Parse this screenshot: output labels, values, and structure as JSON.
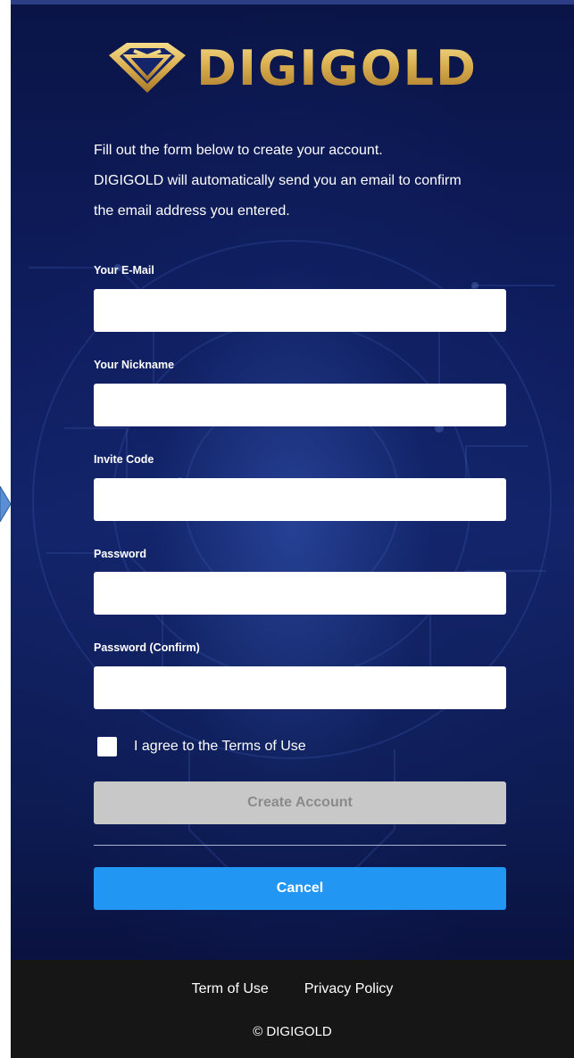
{
  "brand": {
    "name": "DIGIGOLD",
    "gold_light": "#f6dc8c",
    "gold_dark": "#a8772a"
  },
  "intro": {
    "line1": "Fill out the form below to create your account.",
    "line2": "DIGIGOLD will automatically send you an email to confirm",
    "line3": "the email address you entered."
  },
  "form": {
    "email_label": "Your E-Mail",
    "email_value": "",
    "nickname_label": "Your Nickname",
    "nickname_value": "",
    "invite_label": "Invite Code",
    "invite_value": "",
    "password_label": "Password",
    "password_value": "",
    "password_confirm_label": "Password (Confirm)",
    "password_confirm_value": "",
    "agree_label": "I agree to the Terms of Use",
    "agree_checked": false
  },
  "buttons": {
    "create_label": "Create Account",
    "cancel_label": "Cancel"
  },
  "footer": {
    "term_link": "Term of Use",
    "privacy_link": "Privacy Policy",
    "copyright": "© DIGIGOLD"
  },
  "colors": {
    "background": "#0e1c5c",
    "cancel_button": "#2196f3",
    "create_button_disabled": "#c8c8c8",
    "footer": "#161616"
  },
  "icons": {
    "logo": "diamond-icon",
    "side_nav": "left-chevron-arrow-icon"
  }
}
